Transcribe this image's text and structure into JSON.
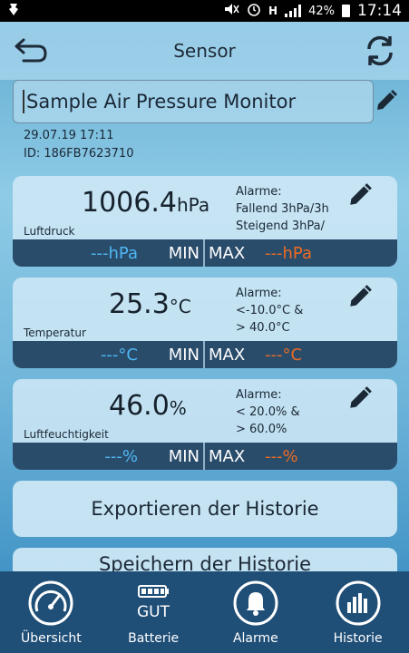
{
  "statusbar": {
    "battery_percent": "42%",
    "time": "17:14",
    "network": "H"
  },
  "appbar": {
    "title": "Sensor"
  },
  "sensor": {
    "name": "Sample Air Pressure Monitor",
    "date": "29.07.19 17:11",
    "id": "ID: 186FB7623710"
  },
  "cards": [
    {
      "value": "1006.4",
      "unit": "hPa",
      "label": "Luftdruck",
      "alarm_title": "Alarme:",
      "alarm_line1": "Fallend 3hPa/3h",
      "alarm_line2": "Steigend 3hPa/",
      "min_value": "---hPa",
      "min_label": "MIN",
      "max_label": "MAX",
      "max_value": "---hPa"
    },
    {
      "value": "25.3",
      "unit": "°C",
      "label": "Temperatur",
      "alarm_title": "Alarme:",
      "alarm_line1": "<-10.0°C &",
      "alarm_line2": "> 40.0°C",
      "min_value": "---°C",
      "min_label": "MIN",
      "max_label": "MAX",
      "max_value": "---°C"
    },
    {
      "value": "46.0",
      "unit": "%",
      "label": "Luftfeuchtigkeit",
      "alarm_title": "Alarme:",
      "alarm_line1": "< 20.0% &",
      "alarm_line2": "> 60.0%",
      "min_value": "---%",
      "min_label": "MIN",
      "max_label": "MAX",
      "max_value": "---%"
    }
  ],
  "buttons": {
    "export": "Exportieren der Historie",
    "second": "Speichern der Historie"
  },
  "nav": [
    {
      "label": "Übersicht",
      "icon": "speedometer-icon"
    },
    {
      "label": "Batterie",
      "icon": "battery-icon",
      "badge": "GUT"
    },
    {
      "label": "Alarme",
      "icon": "bell-icon"
    },
    {
      "label": "Historie",
      "icon": "bar-chart-icon"
    }
  ],
  "colors": {
    "min_value": "#4fb7f2",
    "max_value": "#ec6b22",
    "bar_bg": "#2a4c6b",
    "nav_bg": "#1f4e77"
  }
}
